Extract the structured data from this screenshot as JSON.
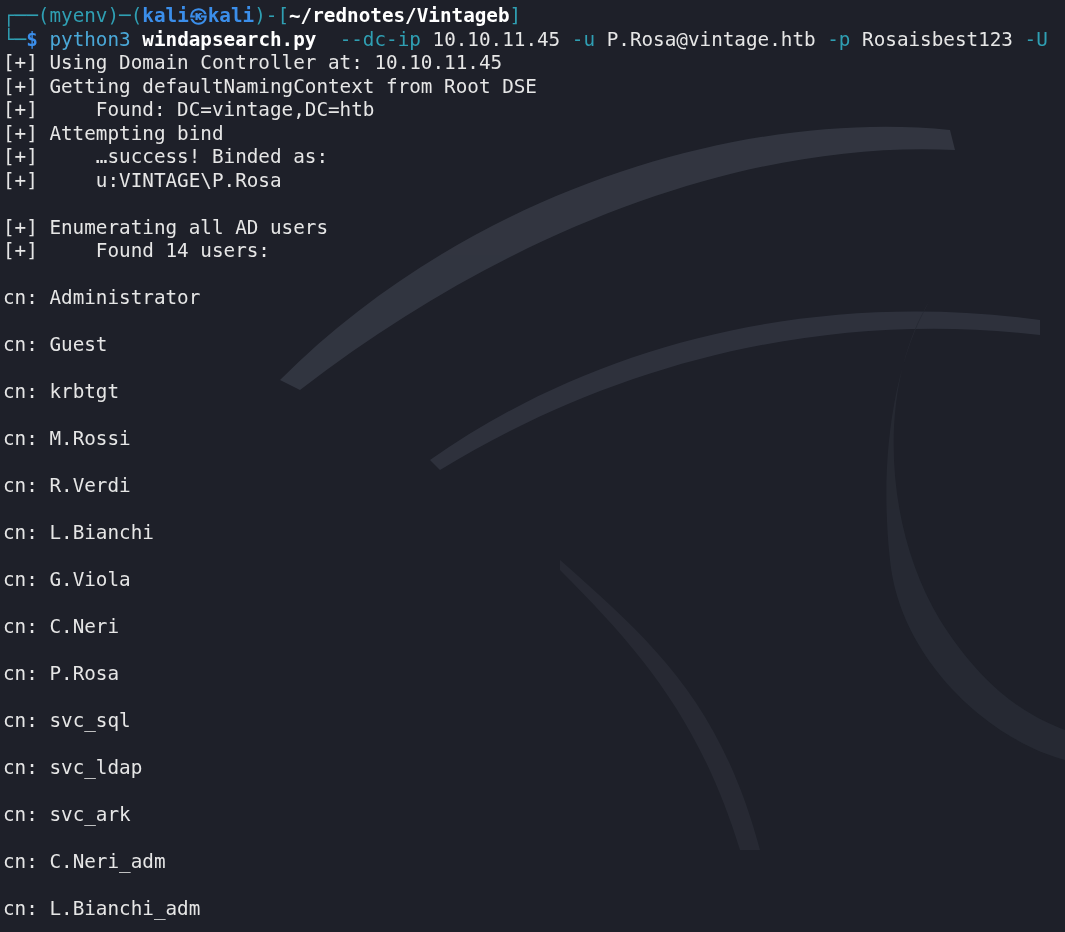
{
  "prompt": [
    {
      "kind": "frame",
      "text": "┌──("
    },
    {
      "kind": "venv",
      "text": "myenv"
    },
    {
      "kind": "frame",
      "text": ")─("
    },
    {
      "kind": "user",
      "text": "kali"
    },
    {
      "kind": "separator",
      "text": "㉿"
    },
    {
      "kind": "host",
      "text": "kali"
    },
    {
      "kind": "frame",
      "text": ")-["
    },
    {
      "kind": "path",
      "text": "~/rednotes/Vintageb"
    },
    {
      "kind": "frame",
      "text": "]"
    }
  ],
  "command": [
    {
      "kind": "frame",
      "text": "└─"
    },
    {
      "kind": "symbol",
      "text": "$"
    },
    {
      "kind": "program",
      "text": "python3"
    },
    {
      "kind": "script",
      "text": "windapsearch.py"
    },
    {
      "kind": "flag",
      "text": "--dc-ip"
    },
    {
      "kind": "value",
      "text": "10.10.11.45"
    },
    {
      "kind": "flag",
      "text": "-u"
    },
    {
      "kind": "value",
      "text": "P.Rosa@vintage.htb"
    },
    {
      "kind": "flag",
      "text": "-p"
    },
    {
      "kind": "value",
      "text": "Rosaisbest123"
    },
    {
      "kind": "flag",
      "text": "-U"
    }
  ],
  "output": [
    {
      "lines": [
        {
          "prefix": "[+]",
          "kind": "status",
          "text": "Using Domain Controller at: 10.10.11.45"
        },
        {
          "prefix": "[+]",
          "kind": "status",
          "text": "Getting defaultNamingContext from Root DSE"
        },
        {
          "prefix": "[+]",
          "kind": "detail",
          "text": "Found: DC=vintage,DC=htb"
        },
        {
          "prefix": "[+]",
          "kind": "status",
          "text": "Attempting bind"
        },
        {
          "prefix": "[+]",
          "kind": "detail",
          "text": "…success! Binded as:"
        },
        {
          "prefix": "[+]",
          "kind": "detail",
          "text": "u:VINTAGE\\P.Rosa"
        }
      ]
    },
    {
      "lines": [
        {
          "prefix": "[+]",
          "kind": "status",
          "text": "Enumerating all AD users"
        },
        {
          "prefix": "[+]",
          "kind": "detail",
          "text": "Found 14 users:"
        }
      ]
    }
  ],
  "users": [
    "cn: Administrator",
    "cn: Guest",
    "cn: krbtgt",
    "cn: M.Rossi",
    "cn: R.Verdi",
    "cn: L.Bianchi",
    "cn: G.Viola",
    "cn: C.Neri",
    "cn: P.Rosa",
    "cn: svc_sql",
    "cn: svc_ldap",
    "cn: svc_ark",
    "cn: C.Neri_adm",
    "cn: L.Bianchi_adm"
  ]
}
